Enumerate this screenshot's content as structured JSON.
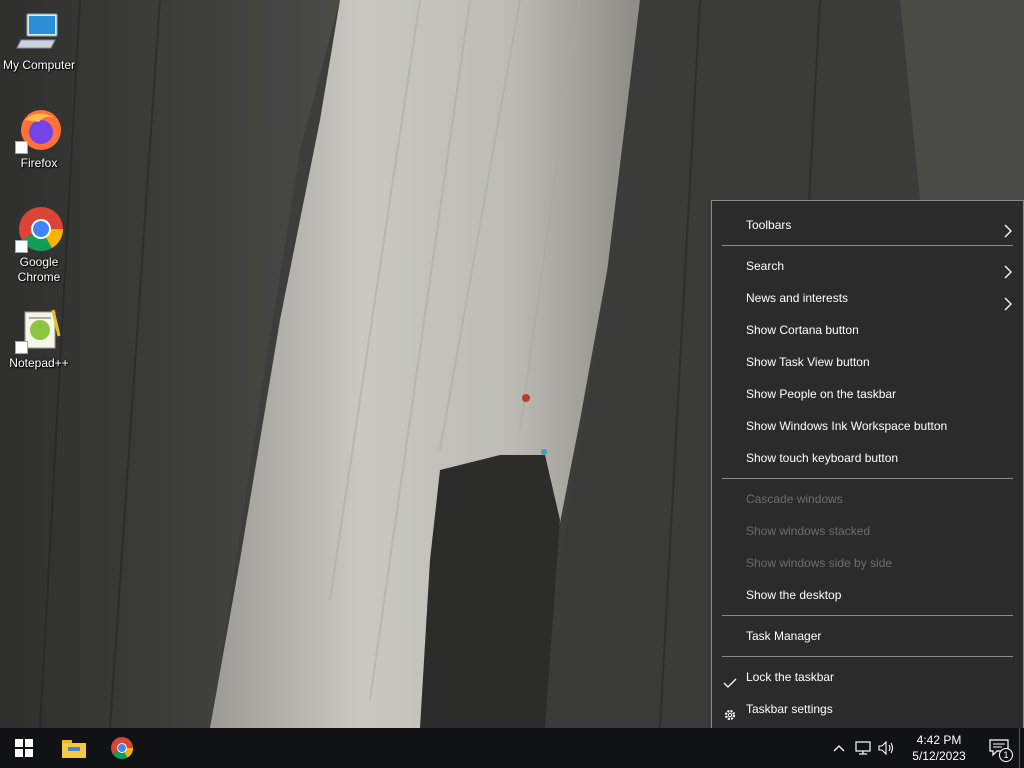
{
  "desktop": {
    "icons": [
      {
        "label": "My Computer",
        "icon": "computer-icon"
      },
      {
        "label": "Firefox",
        "icon": "firefox-icon"
      },
      {
        "label": "Google Chrome",
        "icon": "chrome-icon"
      },
      {
        "label": "Notepad++",
        "icon": "notepadpp-icon"
      }
    ]
  },
  "context_menu": {
    "groups": [
      [
        {
          "label": "Toolbars",
          "submenu": true,
          "enabled": true
        }
      ],
      [
        {
          "label": "Search",
          "submenu": true,
          "enabled": true
        },
        {
          "label": "News and interests",
          "submenu": true,
          "enabled": true
        },
        {
          "label": "Show Cortana button",
          "enabled": true
        },
        {
          "label": "Show Task View button",
          "enabled": true
        },
        {
          "label": "Show People on the taskbar",
          "enabled": true
        },
        {
          "label": "Show Windows Ink Workspace button",
          "enabled": true
        },
        {
          "label": "Show touch keyboard button",
          "enabled": true
        }
      ],
      [
        {
          "label": "Cascade windows",
          "enabled": false
        },
        {
          "label": "Show windows stacked",
          "enabled": false
        },
        {
          "label": "Show windows side by side",
          "enabled": false
        },
        {
          "label": "Show the desktop",
          "enabled": true
        }
      ],
      [
        {
          "label": "Task Manager",
          "enabled": true
        }
      ],
      [
        {
          "label": "Lock the taskbar",
          "enabled": true,
          "checked": true
        },
        {
          "label": "Taskbar settings",
          "enabled": true,
          "icon": "gear-icon"
        }
      ]
    ]
  },
  "taskbar": {
    "pinned": [
      {
        "icon": "file-explorer-icon"
      },
      {
        "icon": "chrome-icon"
      }
    ],
    "tray": {
      "time": "4:42 PM",
      "date": "5/12/2023",
      "notification_count": "1"
    }
  },
  "colors": {
    "menu_bg": "#2b2b2b",
    "menu_border": "#8a8a8a",
    "menu_disabled": "#6d6d6d",
    "taskbar_bg": "#101214"
  }
}
